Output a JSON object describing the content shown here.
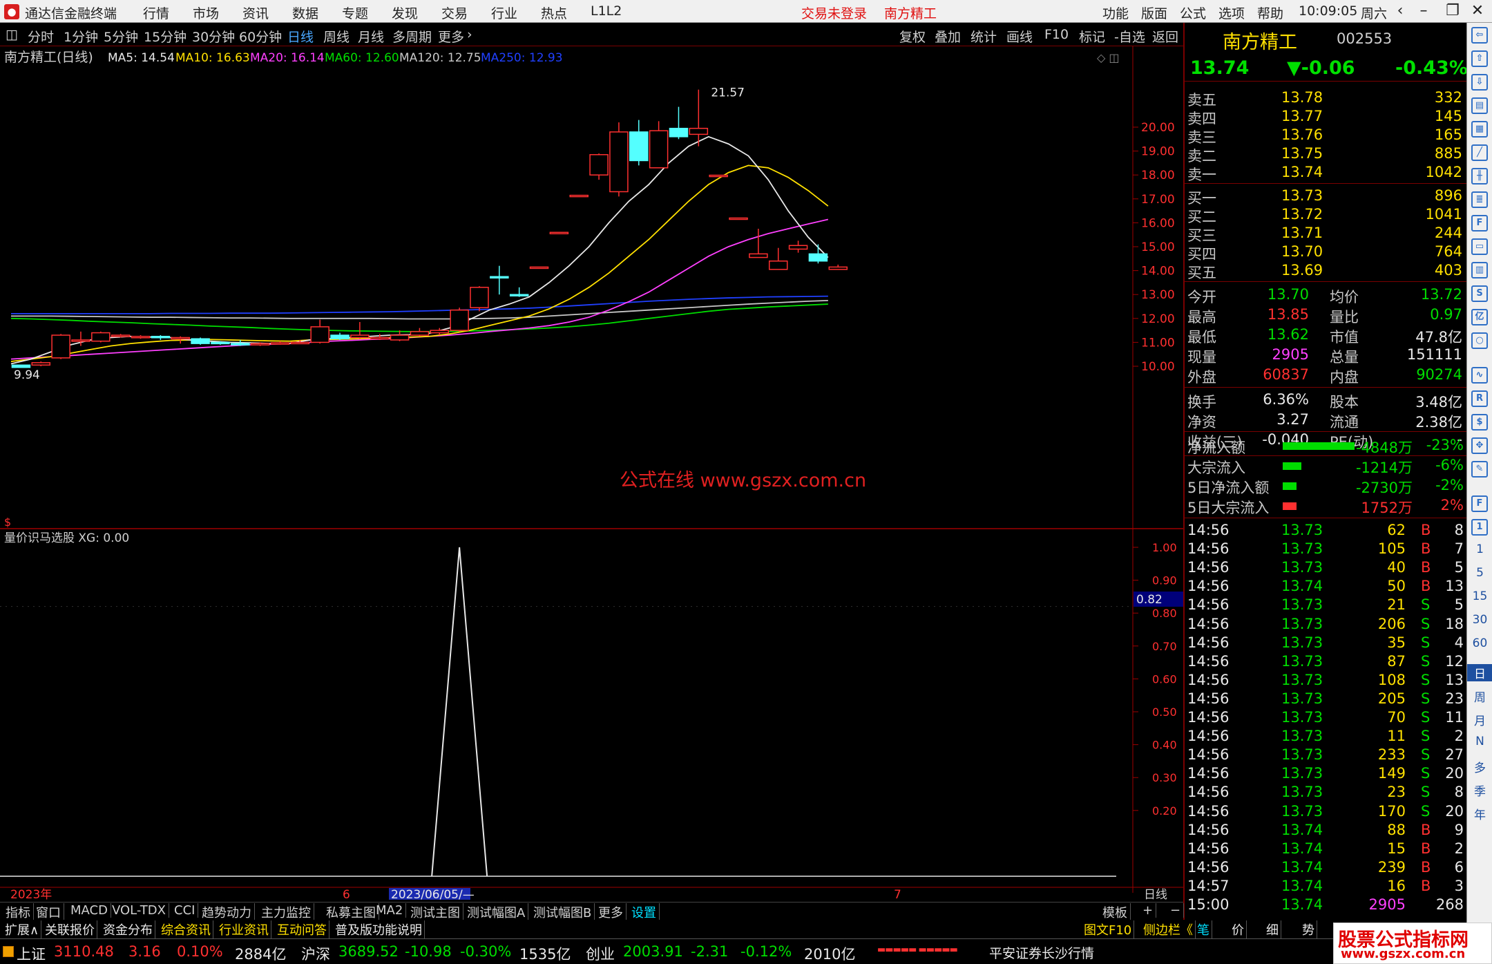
{
  "menubar": {
    "app_title": "通达信金融终端",
    "items": [
      "行情",
      "市场",
      "资讯",
      "数据",
      "专题",
      "发现",
      "交易",
      "行业",
      "热点",
      "L1L2"
    ],
    "login_status": "交易未登录",
    "stock_name": "南方精工",
    "right_items": [
      "功能",
      "版面",
      "公式",
      "选项",
      "帮助"
    ],
    "time": "10:09:05",
    "weekday": "周六"
  },
  "toolbar": {
    "periods": [
      "分时",
      "1分钟",
      "5分钟",
      "15分钟",
      "30分钟",
      "60分钟",
      "日线",
      "周线",
      "月线",
      "多周期",
      "更多"
    ],
    "active_period": "日线",
    "right_buttons": [
      "复权",
      "叠加",
      "统计",
      "画线",
      "F10",
      "标记",
      "-自选",
      "返回"
    ]
  },
  "chart": {
    "header": "南方精工(日线)",
    "ma_labels": [
      {
        "text": "MA5: 14.54",
        "color": "#e8e8e8"
      },
      {
        "text": "MA10: 16.63",
        "color": "#ffe000"
      },
      {
        "text": "MA20: 16.14",
        "color": "#ff40ff"
      },
      {
        "text": "MA60: 12.60",
        "color": "#00dd00"
      },
      {
        "text": "MA120: 12.75",
        "color": "#c8c8c8"
      },
      {
        "text": "MA250: 12.93",
        "color": "#2040ff"
      }
    ],
    "high_label": "21.57",
    "low_label": "9.94",
    "price_ticks": [
      "20.00",
      "19.00",
      "18.00",
      "17.00",
      "16.00",
      "15.00",
      "14.00",
      "13.00",
      "12.00",
      "11.00",
      "10.00"
    ],
    "watermark": "公式在线   www.gszx.com.cn",
    "indicator_header": "量价识马选股  XG: 0.00",
    "ind_ticks": [
      "1.00",
      "0.90",
      "0.80",
      "0.70",
      "0.60",
      "0.50",
      "0.40",
      "0.30",
      "0.20"
    ],
    "ind_marker": "0.82",
    "date_labels": {
      "year": "2023年",
      "m6": "6",
      "cursor": "2023/06/05/—",
      "m7": "7",
      "period": "日线"
    },
    "candles": [
      {
        "o": 10.05,
        "c": 9.95,
        "h": 10.05,
        "l": 9.94
      },
      {
        "o": 10.05,
        "c": 10.15,
        "h": 10.2,
        "l": 10.0
      },
      {
        "o": 10.35,
        "c": 11.3,
        "h": 11.35,
        "l": 10.3
      },
      {
        "o": 11.1,
        "c": 11.1,
        "h": 11.45,
        "l": 10.85
      },
      {
        "o": 11.05,
        "c": 11.4,
        "h": 11.45,
        "l": 11.0
      },
      {
        "o": 11.25,
        "c": 11.3,
        "h": 11.35,
        "l": 11.2
      },
      {
        "o": 11.2,
        "c": 11.25,
        "h": 11.3,
        "l": 11.15
      },
      {
        "o": 11.25,
        "c": 11.2,
        "h": 11.3,
        "l": 11.1
      },
      {
        "o": 11.2,
        "c": 11.2,
        "h": 11.25,
        "l": 10.95
      },
      {
        "o": 11.15,
        "c": 10.95,
        "h": 11.2,
        "l": 10.9
      },
      {
        "o": 11.0,
        "c": 10.95,
        "h": 11.05,
        "l": 10.9
      },
      {
        "o": 10.95,
        "c": 10.9,
        "h": 11.1,
        "l": 10.85
      },
      {
        "o": 10.9,
        "c": 10.95,
        "h": 11.0,
        "l": 10.85
      },
      {
        "o": 10.95,
        "c": 10.98,
        "h": 11.05,
        "l": 10.9
      },
      {
        "o": 11.0,
        "c": 11.0,
        "h": 11.1,
        "l": 10.95
      },
      {
        "o": 11.0,
        "c": 11.65,
        "h": 11.95,
        "l": 10.95
      },
      {
        "o": 11.3,
        "c": 11.15,
        "h": 11.4,
        "l": 11.1
      },
      {
        "o": 11.2,
        "c": 11.3,
        "h": 11.85,
        "l": 11.15
      },
      {
        "o": 11.2,
        "c": 11.2,
        "h": 11.35,
        "l": 11.1
      },
      {
        "o": 11.1,
        "c": 11.3,
        "h": 11.5,
        "l": 11.05
      },
      {
        "o": 11.3,
        "c": 11.45,
        "h": 11.6,
        "l": 11.25
      },
      {
        "o": 11.4,
        "c": 11.5,
        "h": 11.6,
        "l": 11.3
      },
      {
        "o": 11.5,
        "c": 12.35,
        "h": 12.45,
        "l": 11.45
      },
      {
        "o": 12.45,
        "c": 13.3,
        "h": 13.35,
        "l": 12.3
      },
      {
        "o": 13.75,
        "c": 13.7,
        "h": 14.2,
        "l": 13.0
      },
      {
        "o": 13.0,
        "c": 12.95,
        "h": 13.3,
        "l": 12.9
      },
      {
        "o": 14.15,
        "c": 14.15,
        "h": 14.15,
        "l": 14.15
      },
      {
        "o": 15.6,
        "c": 15.6,
        "h": 15.6,
        "l": 15.6
      },
      {
        "o": 17.15,
        "c": 17.15,
        "h": 17.15,
        "l": 17.15
      },
      {
        "o": 18.0,
        "c": 18.85,
        "h": 18.9,
        "l": 17.8
      },
      {
        "o": 17.3,
        "c": 19.8,
        "h": 20.2,
        "l": 17.1
      },
      {
        "o": 19.8,
        "c": 18.6,
        "h": 20.3,
        "l": 18.4
      },
      {
        "o": 18.3,
        "c": 19.85,
        "h": 20.25,
        "l": 18.3
      },
      {
        "o": 19.95,
        "c": 19.6,
        "h": 20.85,
        "l": 19.5
      },
      {
        "o": 19.7,
        "c": 19.95,
        "h": 21.57,
        "l": 19.2
      },
      {
        "o": 17.99,
        "c": 17.99,
        "h": 17.99,
        "l": 17.99
      },
      {
        "o": 16.2,
        "c": 16.2,
        "h": 16.2,
        "l": 16.2
      },
      {
        "o": 14.55,
        "c": 14.7,
        "h": 15.75,
        "l": 14.55
      },
      {
        "o": 14.05,
        "c": 14.4,
        "h": 14.95,
        "l": 14.05
      },
      {
        "o": 14.9,
        "c": 15.05,
        "h": 15.25,
        "l": 14.75
      },
      {
        "o": 14.7,
        "c": 14.4,
        "h": 15.1,
        "l": 14.3
      },
      {
        "o": 14.05,
        "c": 14.15,
        "h": 14.25,
        "l": 14.05
      }
    ],
    "ma5": [
      10.1,
      10.3,
      10.6,
      10.9,
      11.1,
      11.2,
      11.25,
      11.22,
      11.2,
      11.1,
      11.05,
      11.0,
      10.98,
      10.95,
      10.96,
      11.1,
      11.15,
      11.2,
      11.25,
      11.3,
      11.32,
      11.38,
      11.6,
      11.95,
      12.35,
      12.6,
      12.9,
      13.5,
      14.2,
      15.0,
      16.0,
      16.9,
      17.6,
      18.5,
      19.2,
      19.6,
      19.3,
      18.8,
      17.8,
      16.5,
      15.4,
      14.55
    ],
    "ma10": [
      10.2,
      10.3,
      10.4,
      10.55,
      10.7,
      10.85,
      10.95,
      11.02,
      11.08,
      11.1,
      11.12,
      11.1,
      11.08,
      11.06,
      11.05,
      11.1,
      11.12,
      11.14,
      11.17,
      11.2,
      11.22,
      11.25,
      11.35,
      11.5,
      11.7,
      11.9,
      12.1,
      12.4,
      12.8,
      13.3,
      13.9,
      14.6,
      15.3,
      16.1,
      16.9,
      17.6,
      18.1,
      18.4,
      18.3,
      17.9,
      17.35,
      16.7
    ],
    "ma20": [
      10.3,
      10.35,
      10.4,
      10.45,
      10.5,
      10.55,
      10.6,
      10.65,
      10.7,
      10.75,
      10.8,
      10.85,
      10.9,
      10.92,
      10.95,
      11.0,
      11.05,
      11.08,
      11.12,
      11.15,
      11.2,
      11.25,
      11.3,
      11.37,
      11.45,
      11.52,
      11.6,
      11.7,
      11.85,
      12.05,
      12.35,
      12.7,
      13.1,
      13.6,
      14.1,
      14.6,
      15.0,
      15.3,
      15.55,
      15.75,
      15.95,
      16.14
    ],
    "ma60": [
      12.0,
      11.98,
      11.95,
      11.92,
      11.88,
      11.85,
      11.82,
      11.78,
      11.75,
      11.72,
      11.68,
      11.65,
      11.62,
      11.58,
      11.55,
      11.52,
      11.5,
      11.48,
      11.47,
      11.46,
      11.45,
      11.45,
      11.46,
      11.48,
      11.5,
      11.53,
      11.56,
      11.6,
      11.65,
      11.72,
      11.8,
      11.9,
      12.0,
      12.1,
      12.2,
      12.3,
      12.38,
      12.43,
      12.48,
      12.52,
      12.56,
      12.6
    ],
    "ma120": [
      12.1,
      12.1,
      12.1,
      12.09,
      12.08,
      12.07,
      12.06,
      12.05,
      12.05,
      12.04,
      12.03,
      12.02,
      12.02,
      12.01,
      12.0,
      12.0,
      12.0,
      12.0,
      12.0,
      11.99,
      11.98,
      11.98,
      11.98,
      11.99,
      12.0,
      12.02,
      12.05,
      12.1,
      12.15,
      12.2,
      12.25,
      12.3,
      12.35,
      12.4,
      12.45,
      12.5,
      12.55,
      12.6,
      12.64,
      12.68,
      12.72,
      12.75
    ],
    "ma250": [
      12.2,
      12.2,
      12.2,
      12.2,
      12.2,
      12.2,
      12.2,
      12.2,
      12.21,
      12.21,
      12.21,
      12.22,
      12.22,
      12.22,
      12.23,
      12.24,
      12.25,
      12.26,
      12.27,
      12.28,
      12.3,
      12.32,
      12.34,
      12.36,
      12.38,
      12.4,
      12.43,
      12.47,
      12.52,
      12.57,
      12.62,
      12.67,
      12.72,
      12.76,
      12.8,
      12.83,
      12.86,
      12.88,
      12.9,
      12.91,
      12.92,
      12.93
    ],
    "xg_spike_index": 22
  },
  "quote": {
    "name": "南方精工",
    "code": "002553",
    "price": "13.74",
    "change": "▼-0.06",
    "pct": "-0.43%",
    "asks": [
      {
        "label": "卖五",
        "price": "13.78",
        "vol": "332"
      },
      {
        "label": "卖四",
        "price": "13.77",
        "vol": "145"
      },
      {
        "label": "卖三",
        "price": "13.76",
        "vol": "165"
      },
      {
        "label": "卖二",
        "price": "13.75",
        "vol": "885"
      },
      {
        "label": "卖一",
        "price": "13.74",
        "vol": "1042"
      }
    ],
    "bids": [
      {
        "label": "买一",
        "price": "13.73",
        "vol": "896"
      },
      {
        "label": "买二",
        "price": "13.72",
        "vol": "1041"
      },
      {
        "label": "买三",
        "price": "13.71",
        "vol": "244"
      },
      {
        "label": "买四",
        "price": "13.70",
        "vol": "764"
      },
      {
        "label": "买五",
        "price": "13.69",
        "vol": "403"
      }
    ],
    "stats": [
      {
        "l1": "今开",
        "v1": "13.70",
        "c1": "c-green",
        "l2": "均价",
        "v2": "13.72",
        "c2": "c-green"
      },
      {
        "l1": "最高",
        "v1": "13.85",
        "c1": "c-red",
        "l2": "量比",
        "v2": "0.97",
        "c2": "c-green"
      },
      {
        "l1": "最低",
        "v1": "13.62",
        "c1": "c-green",
        "l2": "市值",
        "v2": "47.8亿",
        "c2": "c-white"
      },
      {
        "l1": "现量",
        "v1": "2905",
        "c1": "c-mag",
        "l2": "总量",
        "v2": "151111",
        "c2": "c-white"
      },
      {
        "l1": "外盘",
        "v1": "60837",
        "c1": "c-red",
        "l2": "内盘",
        "v2": "90274",
        "c2": "c-green"
      }
    ],
    "stats2": [
      {
        "l1": "换手",
        "v1": "6.36%",
        "c1": "c-white",
        "l2": "股本",
        "v2": "3.48亿",
        "c2": "c-white"
      },
      {
        "l1": "净资",
        "v1": "3.27",
        "c1": "c-white",
        "l2": "流通",
        "v2": "2.38亿",
        "c2": "c-white"
      },
      {
        "l1": "收益(三)",
        "v1": "-0.040",
        "c1": "c-white",
        "l2": "PE(动)",
        "v2": "-",
        "c2": "c-white"
      }
    ],
    "flows": [
      {
        "label": "净流入额",
        "value": "-4848万",
        "pct": "-23%",
        "frac": 0.23,
        "color": "#00dd00",
        "vc": "c-green"
      },
      {
        "label": "大宗流入",
        "value": "-1214万",
        "pct": "-6%",
        "frac": 0.06,
        "color": "#00dd00",
        "vc": "c-green"
      },
      {
        "label": "5日净流入额",
        "value": "-2730万",
        "pct": "-2%",
        "frac": 0.02,
        "color": "#00dd00",
        "vc": "c-green"
      },
      {
        "label": "5日大宗流入",
        "value": "1752万",
        "pct": "2%",
        "frac": 0.02,
        "color": "#ff3030",
        "vc": "c-red"
      }
    ],
    "ticks": [
      {
        "t": "14:56",
        "p": "13.73",
        "v": "62",
        "d": "B",
        "n": "8"
      },
      {
        "t": "14:56",
        "p": "13.73",
        "v": "105",
        "d": "B",
        "n": "7"
      },
      {
        "t": "14:56",
        "p": "13.73",
        "v": "40",
        "d": "B",
        "n": "5"
      },
      {
        "t": "14:56",
        "p": "13.74",
        "v": "50",
        "d": "B",
        "n": "13"
      },
      {
        "t": "14:56",
        "p": "13.73",
        "v": "21",
        "d": "S",
        "n": "5"
      },
      {
        "t": "14:56",
        "p": "13.73",
        "v": "206",
        "d": "S",
        "n": "18"
      },
      {
        "t": "14:56",
        "p": "13.73",
        "v": "35",
        "d": "S",
        "n": "4"
      },
      {
        "t": "14:56",
        "p": "13.73",
        "v": "87",
        "d": "S",
        "n": "12"
      },
      {
        "t": "14:56",
        "p": "13.73",
        "v": "108",
        "d": "S",
        "n": "13"
      },
      {
        "t": "14:56",
        "p": "13.73",
        "v": "205",
        "d": "S",
        "n": "23"
      },
      {
        "t": "14:56",
        "p": "13.73",
        "v": "70",
        "d": "S",
        "n": "11"
      },
      {
        "t": "14:56",
        "p": "13.73",
        "v": "11",
        "d": "S",
        "n": "2"
      },
      {
        "t": "14:56",
        "p": "13.73",
        "v": "233",
        "d": "S",
        "n": "27"
      },
      {
        "t": "14:56",
        "p": "13.73",
        "v": "149",
        "d": "S",
        "n": "20"
      },
      {
        "t": "14:56",
        "p": "13.73",
        "v": "23",
        "d": "S",
        "n": "8"
      },
      {
        "t": "14:56",
        "p": "13.73",
        "v": "170",
        "d": "S",
        "n": "20"
      },
      {
        "t": "14:56",
        "p": "13.74",
        "v": "88",
        "d": "B",
        "n": "9"
      },
      {
        "t": "14:56",
        "p": "13.74",
        "v": "15",
        "d": "B",
        "n": "2"
      },
      {
        "t": "14:56",
        "p": "13.74",
        "v": "239",
        "d": "B",
        "n": "6"
      },
      {
        "t": "14:57",
        "p": "13.74",
        "v": "16",
        "d": "B",
        "n": "3"
      },
      {
        "t": "15:00",
        "p": "13.74",
        "v": "2905",
        "d": "",
        "n": "268"
      }
    ]
  },
  "bottom_tabs": [
    "指标",
    "窗口",
    "MACD",
    "VOL-TDX",
    "CCI",
    "趋势动力",
    "主力监控",
    "私募主图",
    "MA2",
    "测试主图",
    "测试幅图A",
    "测试幅图B",
    "更多",
    "设置"
  ],
  "bottom_right": [
    "模板",
    "+",
    "−"
  ],
  "info_tabs": [
    "扩展∧",
    "关联报价",
    "资金分布",
    "综合资讯",
    "行业资讯",
    "互动问答",
    "普及版功能说明"
  ],
  "info_right": [
    "图文F10",
    "侧边栏《",
    "笔",
    "价",
    "细",
    "势"
  ],
  "status": {
    "sh": {
      "name": "上证",
      "val": "3110.48",
      "chg": "3.16",
      "pct": "0.10%",
      "amt": "2884亿"
    },
    "hs": {
      "name": "沪深",
      "val": "3689.52",
      "chg": "-10.98",
      "pct": "-0.30%",
      "amt": "1535亿"
    },
    "cy": {
      "name": "创业",
      "val": "2003.91",
      "chg": "-2.31",
      "pct": "-0.12%",
      "amt": "2010亿"
    },
    "server": "平安证券长沙行情"
  },
  "side_icons_text": [
    "日",
    "周",
    "月",
    "N",
    "多",
    "季",
    "年"
  ],
  "side_nums": [
    "1",
    "5",
    "15",
    "30",
    "60"
  ],
  "watermark2": {
    "line1": "股票公式指标网",
    "line2": "www.gszx.com.cn"
  }
}
